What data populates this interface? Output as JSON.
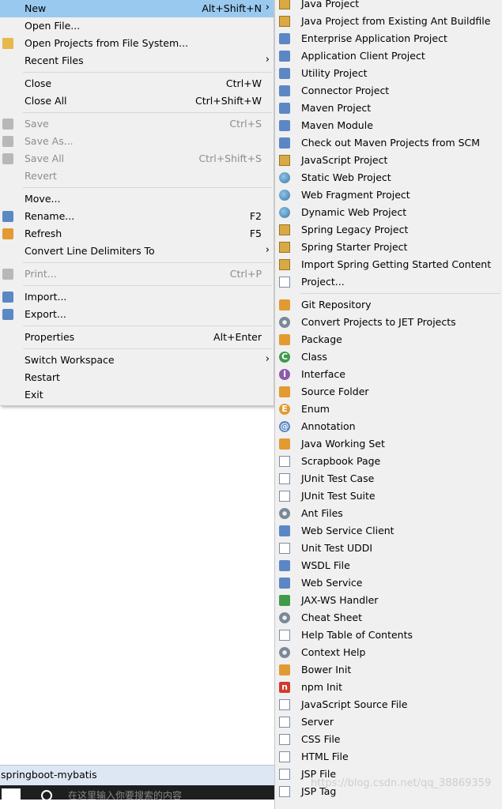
{
  "file_menu": {
    "items": [
      {
        "label": "New",
        "shortcut": "Alt+Shift+N",
        "submenu": true,
        "highlighted": true,
        "icon": "none"
      },
      {
        "label": "Open File...",
        "icon": "none"
      },
      {
        "label": "Open Projects from File System...",
        "icon": "folder-icon"
      },
      {
        "label": "Recent Files",
        "submenu": true,
        "icon": "none"
      },
      {
        "separator": true
      },
      {
        "label": "Close",
        "shortcut": "Ctrl+W",
        "icon": "none"
      },
      {
        "label": "Close All",
        "shortcut": "Ctrl+Shift+W",
        "icon": "none"
      },
      {
        "separator": true
      },
      {
        "label": "Save",
        "shortcut": "Ctrl+S",
        "disabled": true,
        "icon": "save-icon"
      },
      {
        "label": "Save As...",
        "disabled": true,
        "icon": "save-as-icon"
      },
      {
        "label": "Save All",
        "shortcut": "Ctrl+Shift+S",
        "disabled": true,
        "icon": "save-all-icon"
      },
      {
        "label": "Revert",
        "disabled": true,
        "icon": "none"
      },
      {
        "separator": true
      },
      {
        "label": "Move...",
        "icon": "none"
      },
      {
        "label": "Rename...",
        "shortcut": "F2",
        "icon": "rename-icon"
      },
      {
        "label": "Refresh",
        "shortcut": "F5",
        "icon": "refresh-icon"
      },
      {
        "label": "Convert Line Delimiters To",
        "submenu": true,
        "icon": "none"
      },
      {
        "separator": true
      },
      {
        "label": "Print...",
        "shortcut": "Ctrl+P",
        "disabled": true,
        "icon": "print-icon"
      },
      {
        "separator": true
      },
      {
        "label": "Import...",
        "icon": "import-icon"
      },
      {
        "label": "Export...",
        "icon": "export-icon"
      },
      {
        "separator": true
      },
      {
        "label": "Properties",
        "shortcut": "Alt+Enter",
        "icon": "none"
      },
      {
        "separator": true
      },
      {
        "label": "Switch Workspace",
        "submenu": true,
        "icon": "none"
      },
      {
        "label": "Restart",
        "icon": "none"
      },
      {
        "label": "Exit",
        "icon": "none"
      }
    ]
  },
  "new_menu": {
    "items": [
      {
        "label": "Java Project",
        "icon": "java-project-icon"
      },
      {
        "label": "Java Project from Existing Ant Buildfile",
        "icon": "ant-project-icon"
      },
      {
        "label": "Enterprise Application Project",
        "icon": "ear-project-icon"
      },
      {
        "label": "Application Client Project",
        "icon": "app-client-icon"
      },
      {
        "label": "Utility Project",
        "icon": "utility-project-icon"
      },
      {
        "label": "Connector Project",
        "icon": "connector-project-icon"
      },
      {
        "label": "Maven Project",
        "icon": "maven-project-icon"
      },
      {
        "label": "Maven Module",
        "icon": "maven-module-icon"
      },
      {
        "label": "Check out Maven Projects from SCM",
        "icon": "maven-scm-icon"
      },
      {
        "label": "JavaScript Project",
        "icon": "javascript-project-icon"
      },
      {
        "label": "Static Web Project",
        "icon": "static-web-icon"
      },
      {
        "label": "Web Fragment Project",
        "icon": "web-fragment-icon"
      },
      {
        "label": "Dynamic Web Project",
        "icon": "dynamic-web-icon"
      },
      {
        "label": "Spring Legacy Project",
        "icon": "spring-legacy-icon"
      },
      {
        "label": "Spring Starter Project",
        "icon": "spring-starter-icon"
      },
      {
        "label": "Import Spring Getting Started Content",
        "icon": "spring-import-icon"
      },
      {
        "label": "Project...",
        "icon": "project-icon"
      },
      {
        "separator": true
      },
      {
        "label": "Git Repository",
        "icon": "git-icon"
      },
      {
        "label": "Convert Projects to JET Projects",
        "icon": "jet-icon"
      },
      {
        "label": "Package",
        "icon": "package-icon"
      },
      {
        "label": "Class",
        "icon": "class-icon"
      },
      {
        "label": "Interface",
        "icon": "interface-icon"
      },
      {
        "label": "Source Folder",
        "icon": "source-folder-icon"
      },
      {
        "label": "Enum",
        "icon": "enum-icon"
      },
      {
        "label": "Annotation",
        "icon": "annotation-icon"
      },
      {
        "label": "Java Working Set",
        "icon": "working-set-icon"
      },
      {
        "label": "Scrapbook Page",
        "icon": "scrapbook-icon"
      },
      {
        "label": "JUnit Test Case",
        "icon": "junit-case-icon"
      },
      {
        "label": "JUnit Test Suite",
        "icon": "junit-suite-icon"
      },
      {
        "label": "Ant Files",
        "icon": "ant-icon"
      },
      {
        "label": "Web Service Client",
        "icon": "ws-client-icon"
      },
      {
        "label": "Unit Test UDDI",
        "icon": "uddi-icon"
      },
      {
        "label": "WSDL File",
        "icon": "wsdl-icon"
      },
      {
        "label": "Web Service",
        "icon": "web-service-icon"
      },
      {
        "label": "JAX-WS Handler",
        "icon": "jaxws-icon"
      },
      {
        "label": "Cheat Sheet",
        "icon": "cheat-sheet-icon"
      },
      {
        "label": "Help Table of Contents",
        "icon": "help-toc-icon"
      },
      {
        "label": "Context Help",
        "icon": "context-help-icon"
      },
      {
        "label": "Bower Init",
        "icon": "bower-icon"
      },
      {
        "label": "npm Init",
        "icon": "npm-icon"
      },
      {
        "label": "JavaScript Source File",
        "icon": "js-file-icon"
      },
      {
        "label": "Server",
        "icon": "server-icon"
      },
      {
        "label": "CSS File",
        "icon": "css-file-icon"
      },
      {
        "label": "HTML File",
        "icon": "html-file-icon"
      },
      {
        "label": "JSP File",
        "icon": "jsp-file-icon"
      },
      {
        "label": "JSP Tag",
        "icon": "jsp-tag-icon"
      }
    ]
  },
  "project_explorer": {
    "label": "springboot-mybatis"
  },
  "taskbar": {
    "search_placeholder": "在这里输入你要搜索的内容"
  },
  "watermark": "https://blog.csdn.net/qq_38869359",
  "colors": {
    "menu_bg": "#f0f0f0",
    "highlight": "#99c9ef",
    "disabled_text": "#8d8d8d",
    "separator": "#d7d7d7"
  }
}
